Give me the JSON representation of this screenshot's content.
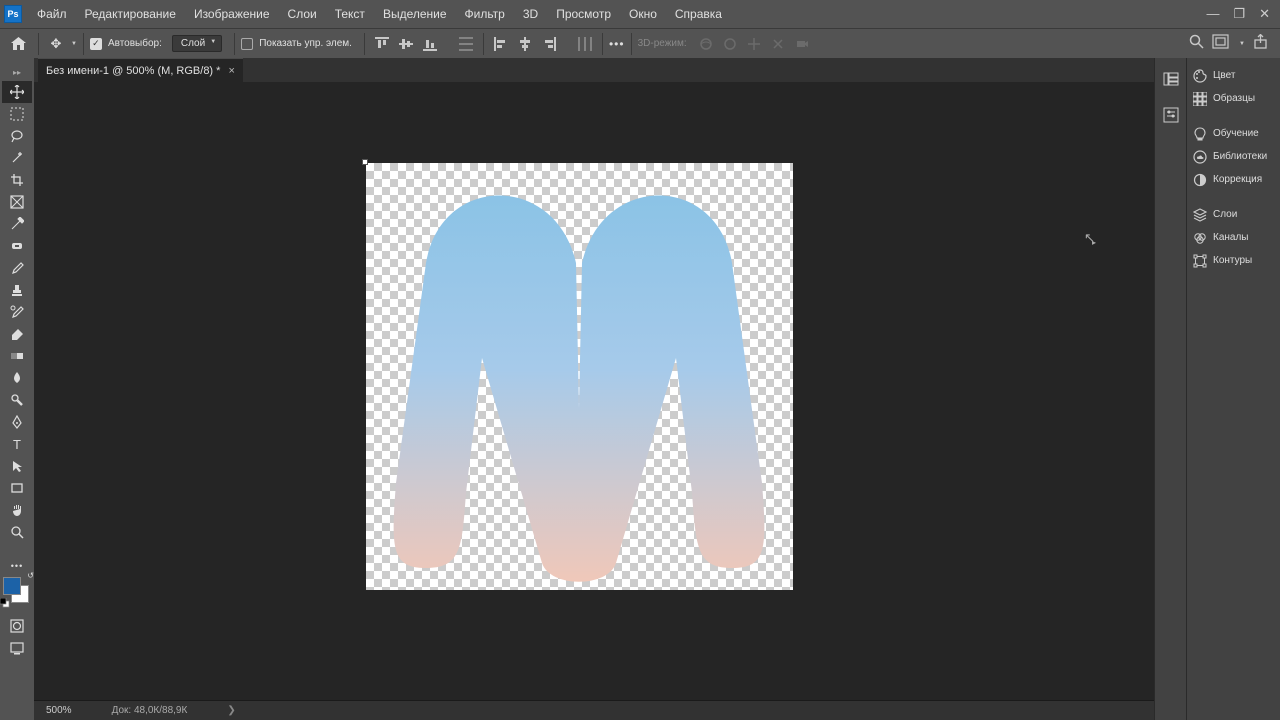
{
  "menu": {
    "items": [
      "Файл",
      "Редактирование",
      "Изображение",
      "Слои",
      "Текст",
      "Выделение",
      "Фильтр",
      "3D",
      "Просмотр",
      "Окно",
      "Справка"
    ]
  },
  "options": {
    "autoselect": "Автовыбор:",
    "target": "Слой",
    "show_controls": "Показать упр. элем.",
    "mode3d": "3D-режим:"
  },
  "tab": {
    "title": "Без имени-1 @ 500% (M, RGB/8) *"
  },
  "status": {
    "zoom": "500%",
    "doc": "Док: 48,0К/88,9К"
  },
  "panels": {
    "color": "Цвет",
    "swatches": "Образцы",
    "learn": "Обучение",
    "libs": "Библиотеки",
    "adjust": "Коррекция",
    "layers": "Слои",
    "channels": "Каналы",
    "paths": "Контуры"
  },
  "colors": {
    "fg": "#1c62a7",
    "bg": "#ffffff"
  }
}
